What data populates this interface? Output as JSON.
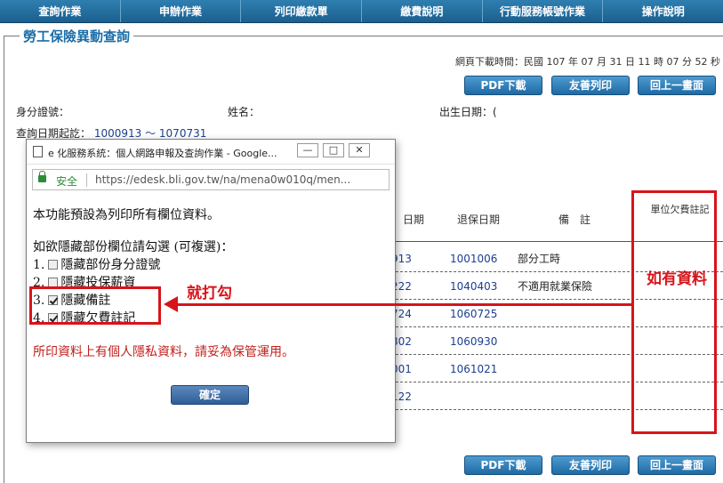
{
  "nav": [
    "查詢作業",
    "申辦作業",
    "列印繳款單",
    "繳費說明",
    "行動服務帳號作業",
    "操作說明"
  ],
  "page_title": "勞工保險異動查詢",
  "download_time": "網頁下載時間：民國 107 年 07 月 31 日 11 時 07 分 52 秒",
  "buttons": {
    "pdf": "PDF下載",
    "print": "友善列印",
    "back": "回上一畫面"
  },
  "info": {
    "id_label": "身分證號：",
    "name_label": "姓名：",
    "dob_label": "出生日期：(",
    "range_label": "查詢日期起訖：",
    "range_value": "1000913 ～ 1070731"
  },
  "table": {
    "headers": {
      "date_partial": "日期",
      "withdraw": "退保日期",
      "remark": "備　註",
      "arrears": "單位欠費註記"
    },
    "rows": [
      {
        "date": "913",
        "withdraw": "1001006",
        "remark": "部分工時"
      },
      {
        "date": "222",
        "withdraw": "1040403",
        "remark": "不適用就業保險"
      },
      {
        "date": "724",
        "withdraw": "1060725",
        "remark": ""
      },
      {
        "date": "802",
        "withdraw": "1060930",
        "remark": ""
      },
      {
        "date": "001",
        "withdraw": "1061021",
        "remark": ""
      },
      {
        "date": "122",
        "withdraw": "",
        "remark": ""
      }
    ]
  },
  "annotation": {
    "right_note": "如有資料",
    "arrow_note": "就打勾"
  },
  "popup": {
    "title": "e 化服務系統：個人網路申報及查詢作業 - Google...",
    "controls": {
      "min": "—",
      "max": "□",
      "close": "✕"
    },
    "secure": "安全",
    "url": "https://edesk.bli.gov.tw/na/mena0w010q/men...",
    "intro": "本功能預設為列印所有欄位資料。",
    "instruction": "如欲隱藏部份欄位請勾選 (可複選)：",
    "options": [
      {
        "num": "1.",
        "label": "隱藏部份身分證號",
        "checked": false
      },
      {
        "num": "2.",
        "label": "隱藏投保薪資",
        "checked": false
      },
      {
        "num": "3.",
        "label": "隱藏備註",
        "checked": true
      },
      {
        "num": "4.",
        "label": "隱藏欠費註記",
        "checked": true
      }
    ],
    "warning": "所印資料上有個人隱私資料，請妥為保管運用。",
    "ok": "確定"
  },
  "colors": {
    "accent": "#1b6ea8",
    "annotation_red": "#d7141a",
    "warning_red": "#c0201c"
  }
}
